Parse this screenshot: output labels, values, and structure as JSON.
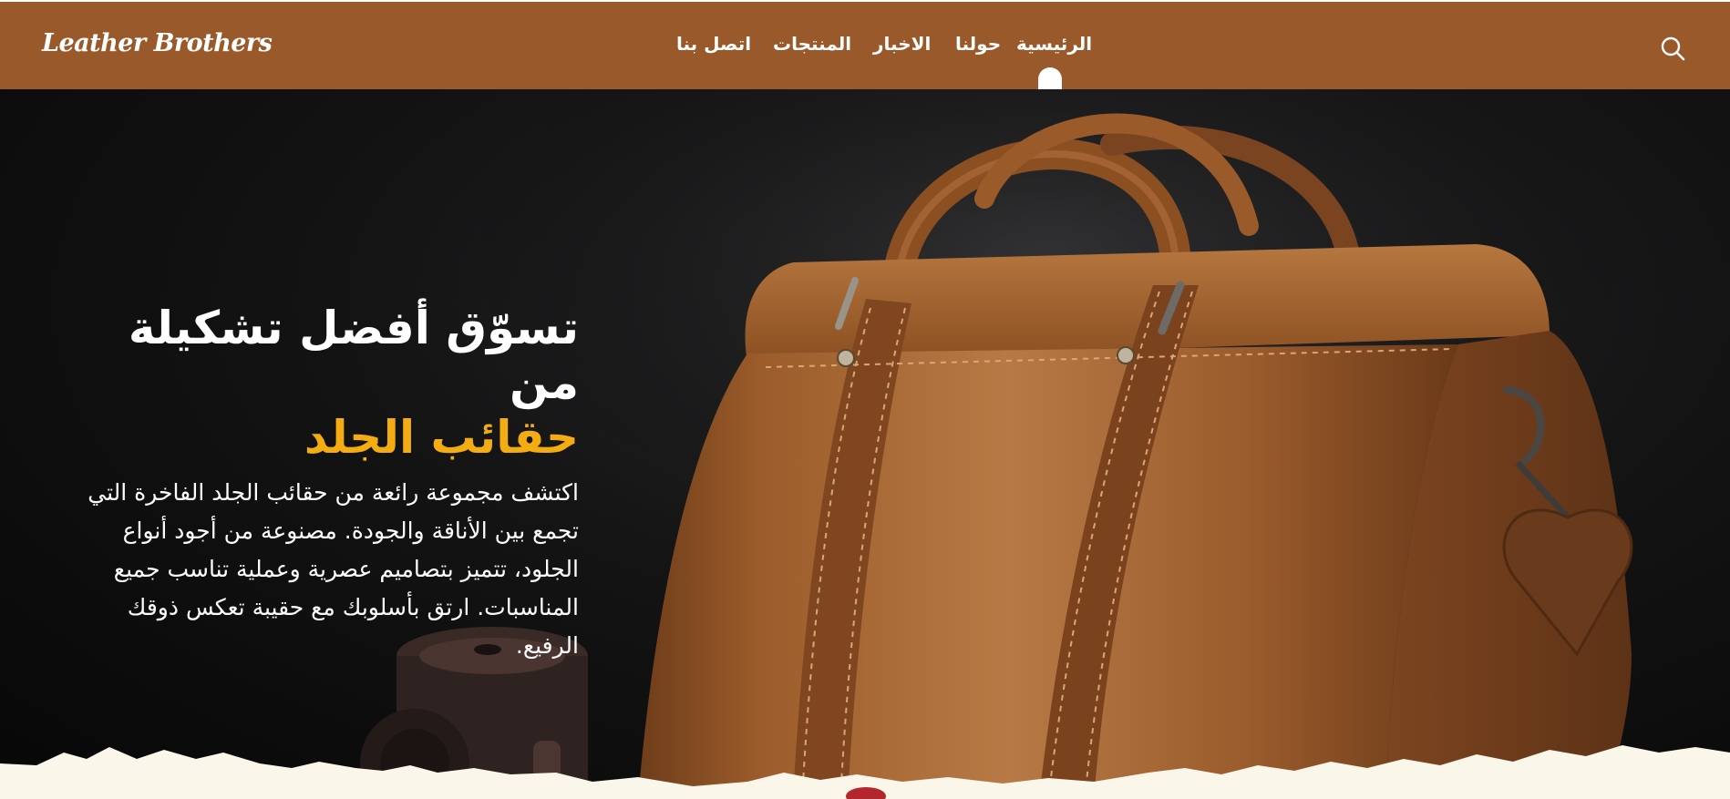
{
  "brand": {
    "logo_text": "Leather Brothers"
  },
  "nav": {
    "items": [
      {
        "label": "الرئيسية",
        "active": true
      },
      {
        "label": "حولنا"
      },
      {
        "label": "الاخبار"
      },
      {
        "label": "المنتجات"
      },
      {
        "label": "اتصل بنا"
      }
    ],
    "search_icon": "search-icon"
  },
  "hero": {
    "title_line1": "تسوّق أفضل تشكيلة من",
    "title_line2": "حقائب الجلد",
    "description": "اكتشف مجموعة رائعة من حقائب الجلد الفاخرة التي تجمع بين الأناقة والجودة. مصنوعة من أجود أنواع الجلود، تتميز بتصاميم عصرية وعملية تناسب جميع المناسبات. ارتق بأسلوبك مع حقيبة تعكس ذوقك الرفيع."
  },
  "colors": {
    "header_bg": "#9a592a",
    "accent": "#f3ac12",
    "hero_bg": "#0c0c0c",
    "leather": "#a0602c"
  }
}
